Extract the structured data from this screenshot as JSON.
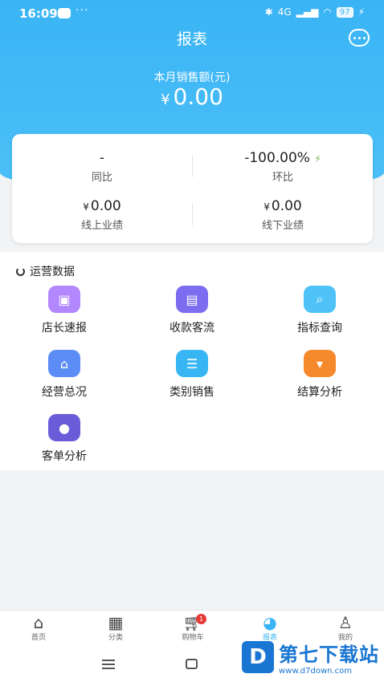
{
  "status_bar": {
    "time": "16:09",
    "dots": "···",
    "signal": "4G",
    "battery": "97"
  },
  "header": {
    "title": "报表",
    "message_icon": "chat-bubble-icon"
  },
  "summary": {
    "label": "本月销售额(元)",
    "currency": "¥",
    "value": "0.00"
  },
  "card": {
    "yoy": {
      "value": "-",
      "label": "同比"
    },
    "mom": {
      "value": "-100.00%",
      "label": "环比",
      "icon": "⚡"
    },
    "online": {
      "currency": "¥",
      "value": "0.00",
      "label": "线上业绩"
    },
    "offline": {
      "currency": "¥",
      "value": "0.00",
      "label": "线下业绩"
    }
  },
  "ops": {
    "title": "运营数据",
    "items": [
      {
        "label": "店长速报",
        "color": "#b388ff",
        "icon": "report-image-icon"
      },
      {
        "label": "收款客流",
        "color": "#7c6cf0",
        "icon": "cashier-icon"
      },
      {
        "label": "指标查询",
        "color": "#4fc3f7",
        "icon": "index-search-icon"
      },
      {
        "label": "经营总况",
        "color": "#5c8df6",
        "icon": "store-icon"
      },
      {
        "label": "类别销售",
        "color": "#38b6f4",
        "icon": "list-icon"
      },
      {
        "label": "结算分析",
        "color": "#f5892c",
        "icon": "wallet-icon"
      },
      {
        "label": "客单分析",
        "color": "#6a5cd8",
        "icon": "customer-icon"
      }
    ]
  },
  "tabbar": {
    "home": "首页",
    "category": "分类",
    "cart": "购物车",
    "cart_badge": "1",
    "report": "报表",
    "mine": "我的"
  },
  "watermark": {
    "title": "第七下载站",
    "url": "www.d7down.com",
    "logo": "D"
  }
}
